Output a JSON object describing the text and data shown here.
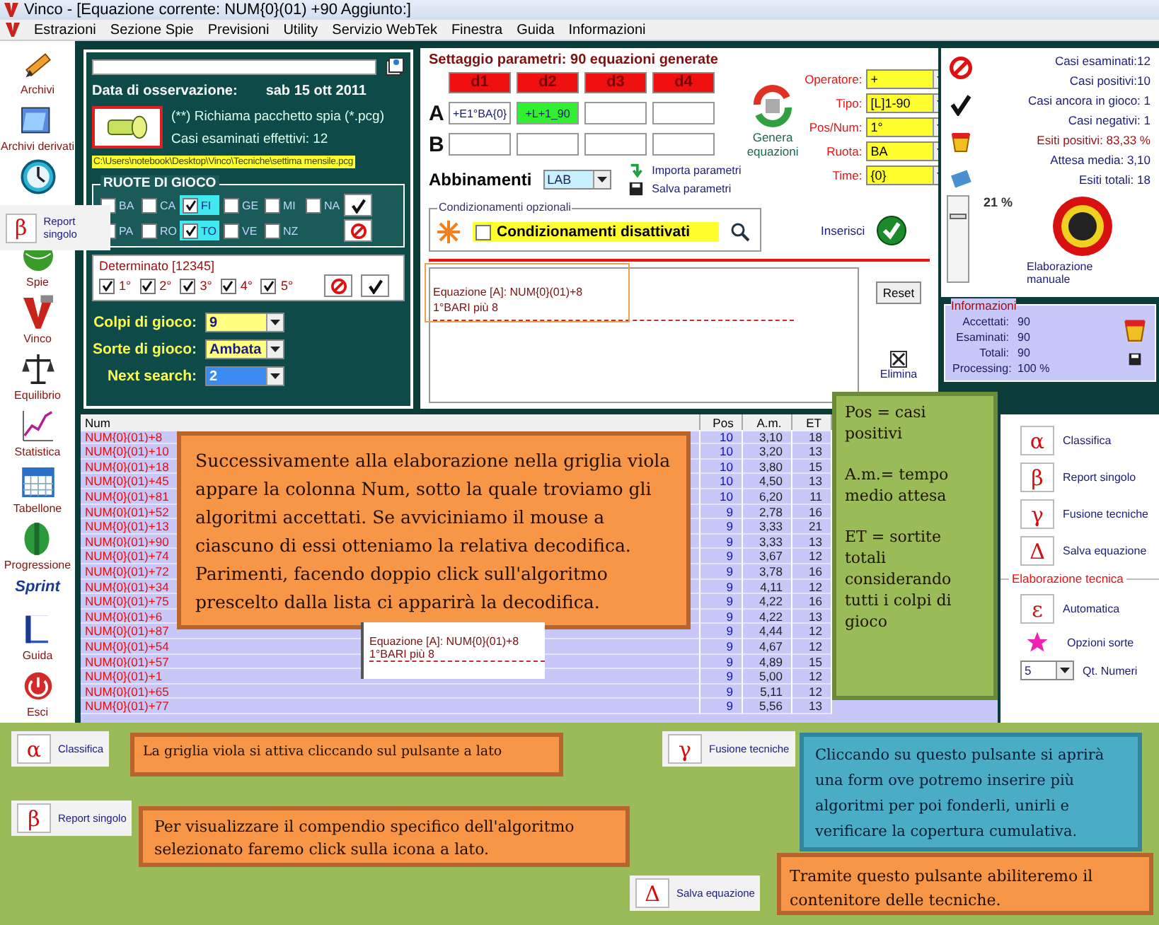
{
  "window": {
    "title": "Vinco - [Equazione corrente: NUM{0}(01) +90 Aggiunto:]"
  },
  "menu": [
    "Estrazioni",
    "Sezione Spie",
    "Previsioni",
    "Utility",
    "Servizio WebTek",
    "Finestra",
    "Guida",
    "Informazioni"
  ],
  "toolbar": [
    {
      "kind": "tool",
      "label": "Archivi"
    },
    {
      "kind": "tool",
      "label": "Archivi derivati"
    },
    {
      "kind": "icon"
    },
    {
      "kind": "tool",
      "label": "Spie"
    },
    {
      "kind": "tool",
      "label": "Vinco"
    },
    {
      "kind": "tool",
      "label": "Equilibrio"
    },
    {
      "kind": "tool",
      "label": "Statistica"
    },
    {
      "kind": "tool",
      "label": "Tabellone"
    },
    {
      "kind": "tool",
      "label": "Progressione"
    },
    {
      "kind": "logo",
      "label": "Sprint"
    },
    {
      "kind": "tool",
      "label": "Guida"
    },
    {
      "kind": "tool",
      "label": "Esci"
    }
  ],
  "tooltip": {
    "symbol": "β",
    "label": "Report singolo"
  },
  "observation": {
    "label": "Data di osservazione:",
    "date": "sab 15 ott 2011",
    "hint": "(**) Richiama pacchetto spia (*.pcg)",
    "cases": "Casi esaminati effettivi: 12",
    "path": "C:\\Users\\notebook\\Desktop\\Vinco\\Tecniche\\settima mensile.pcg"
  },
  "wheels": {
    "title": "RUOTE DI GIOCO",
    "items": [
      {
        "label": "BA",
        "checked": false
      },
      {
        "label": "CA",
        "checked": false
      },
      {
        "label": "FI",
        "checked": true
      },
      {
        "label": "GE",
        "checked": false
      },
      {
        "label": "MI",
        "checked": false
      },
      {
        "label": "NA",
        "checked": false
      },
      {
        "label": "PA",
        "checked": false
      },
      {
        "label": "RO",
        "checked": false
      },
      {
        "label": "TO",
        "checked": true
      },
      {
        "label": "VE",
        "checked": false
      },
      {
        "label": "NZ",
        "checked": false
      }
    ]
  },
  "determinato": {
    "title": "Determinato [12345]",
    "items": [
      {
        "label": "1°",
        "checked": true
      },
      {
        "label": "2°",
        "checked": true
      },
      {
        "label": "3°",
        "checked": true
      },
      {
        "label": "4°",
        "checked": true
      },
      {
        "label": "5°",
        "checked": true
      }
    ]
  },
  "play": [
    {
      "label": "Colpi di gioco:",
      "value": "9",
      "kind": "yellow"
    },
    {
      "label": "Sorte di gioco:",
      "value": "Ambata",
      "kind": "yellow"
    },
    {
      "label": "Next search:",
      "value": "2",
      "kind": "blue"
    }
  ],
  "settings": {
    "title": "Settaggio parametri: 90 equazioni generate",
    "columns": [
      "d1",
      "d2",
      "d3",
      "d4"
    ],
    "rows": [
      {
        "label": "A",
        "cells": [
          {
            "kind": "plain",
            "value": "+E1°BA{0}"
          },
          {
            "kind": "green",
            "value": "+L+1_90"
          },
          {
            "kind": "empty"
          },
          {
            "kind": "empty"
          }
        ]
      },
      {
        "label": "B",
        "cells": [
          {
            "kind": "empty"
          },
          {
            "kind": "empty"
          },
          {
            "kind": "empty"
          },
          {
            "kind": "empty"
          }
        ]
      }
    ],
    "generate": "Genera equazioni",
    "params": [
      {
        "label": "Operatore:",
        "value": "+"
      },
      {
        "label": "Tipo:",
        "value": "[L]1-90"
      },
      {
        "label": "Pos/Num:",
        "value": "1°"
      },
      {
        "label": "Ruota:",
        "value": "BA"
      },
      {
        "label": "Time:",
        "value": "{0}"
      }
    ],
    "abbinamenti": {
      "label": "Abbinamenti",
      "value": "LAB"
    },
    "actions": [
      "Importa parametri",
      "Salva parametri"
    ],
    "conditions": {
      "title": "Condizionamenti opzionali",
      "label": "Condizionamenti disattivati",
      "checked": false
    },
    "insert": "Inserisci",
    "output": [
      "Equazione [A]: NUM{0}(01)+8",
      "1°BARI  più 8"
    ],
    "reset": "Reset",
    "delete": "Elimina"
  },
  "stats": [
    {
      "kind": "plain",
      "text": "Casi esaminati:12"
    },
    {
      "kind": "plain",
      "text": "Casi positivi:10"
    },
    {
      "kind": "plain",
      "text": "Casi ancora in gioco: 1"
    },
    {
      "kind": "plain",
      "text": "Casi negativi: 1"
    },
    {
      "kind": "alert",
      "text": "Esiti positivi: 83,33 %"
    },
    {
      "kind": "plain",
      "text": "Attesa media: 3,10"
    },
    {
      "kind": "plain",
      "text": "Esiti totali: 18"
    }
  ],
  "slider": {
    "level": 0.79,
    "reading": "21 %"
  },
  "manual": "Elaborazione manuale",
  "info": {
    "title": "Informazioni",
    "rows": [
      [
        "Accettati:",
        "90"
      ],
      [
        "Esaminati:",
        "90"
      ],
      [
        "Totali:",
        "90"
      ],
      [
        "Processing:",
        "100 %"
      ]
    ]
  },
  "table": {
    "columns": [
      "Num",
      "Pos",
      "A.m.",
      "ET"
    ],
    "rows": [
      [
        "NUM{0}(01)+8",
        "10",
        "3,10",
        "18"
      ],
      [
        "NUM{0}(01)+10",
        "10",
        "3,20",
        "13"
      ],
      [
        "NUM{0}(01)+18",
        "10",
        "3,80",
        "15"
      ],
      [
        "NUM{0}(01)+45",
        "10",
        "4,50",
        "13"
      ],
      [
        "NUM{0}(01)+81",
        "10",
        "6,20",
        "11"
      ],
      [
        "NUM{0}(01)+52",
        "9",
        "2,78",
        "16"
      ],
      [
        "NUM{0}(01)+13",
        "9",
        "3,33",
        "21"
      ],
      [
        "NUM{0}(01)+90",
        "9",
        "3,33",
        "13"
      ],
      [
        "NUM{0}(01)+74",
        "9",
        "3,67",
        "12"
      ],
      [
        "NUM{0}(01)+72",
        "9",
        "3,78",
        "16"
      ],
      [
        "NUM{0}(01)+34",
        "9",
        "4,11",
        "12"
      ],
      [
        "NUM{0}(01)+75",
        "9",
        "4,22",
        "16"
      ],
      [
        "NUM{0}(01)+6",
        "9",
        "4,22",
        "13"
      ],
      [
        "NUM{0}(01)+87",
        "9",
        "4,44",
        "12"
      ],
      [
        "NUM{0}(01)+54",
        "9",
        "4,67",
        "12"
      ],
      [
        "NUM{0}(01)+57",
        "9",
        "4,89",
        "15"
      ],
      [
        "NUM{0}(01)+1",
        "9",
        "5,00",
        "12"
      ],
      [
        "NUM{0}(01)+65",
        "9",
        "5,11",
        "12"
      ],
      [
        "NUM{0}(01)+77",
        "9",
        "5,56",
        "13"
      ]
    ],
    "tooltip": [
      "Equazione [A]: NUM{0}(01)+8",
      "1°BARI  più 8"
    ]
  },
  "side": [
    {
      "symbol": "α",
      "label": "Classifica"
    },
    {
      "symbol": "β",
      "label": "Report singolo"
    },
    {
      "symbol": "γ",
      "label": "Fusione tecniche"
    },
    {
      "symbol": "Δ",
      "label": "Salva equazione"
    }
  ],
  "technical": {
    "title": "Elaborazione tecnica",
    "buttons": [
      {
        "kind": "symbol",
        "symbol": "ε",
        "label": "Automatica"
      },
      {
        "kind": "star",
        "label": "Opzioni sorte"
      }
    ],
    "qty": {
      "value": "5",
      "label": "Qt. Numeri"
    }
  },
  "notes": [
    {
      "kind": "orange",
      "text": "Successivamente alla elaborazione nella griglia viola appare la colonna Num, sotto la quale troviamo gli algoritmi accettati. Se avviciniamo il mouse a ciascuno di essi otteniamo la relativa decodifica. Parimenti, facendo doppio click sull'algoritmo prescelto dalla lista ci apparirà la decodifica."
    },
    {
      "kind": "green",
      "paragraphs": [
        "Pos = casi positivi",
        "A.m.= tempo medio attesa",
        "ET = sortite totali considerando tutti i colpi di gioco"
      ]
    }
  ],
  "legend": {
    "buttons": [
      {
        "symbol": "α",
        "label": "Classifica"
      },
      {
        "symbol": "β",
        "label": "Report singolo"
      },
      {
        "symbol": "γ",
        "label": "Fusione tecniche"
      },
      {
        "symbol": "Δ",
        "label": "Salva equazione"
      }
    ],
    "notes": [
      {
        "kind": "orange",
        "text": "La griglia viola si attiva cliccando sul pulsante a lato"
      },
      {
        "kind": "orange",
        "text": "Per visualizzare il compendio specifico dell'algoritmo selezionato faremo click sulla icona a lato."
      },
      {
        "kind": "blue",
        "text": "Cliccando su questo pulsante si aprirà una form ove potremo inserire più algoritmi per poi fonderli, unirli e verificare la copertura cumulativa."
      },
      {
        "kind": "orange",
        "text": "Tramite questo pulsante abiliteremo il contenitore delle tecniche."
      }
    ]
  }
}
